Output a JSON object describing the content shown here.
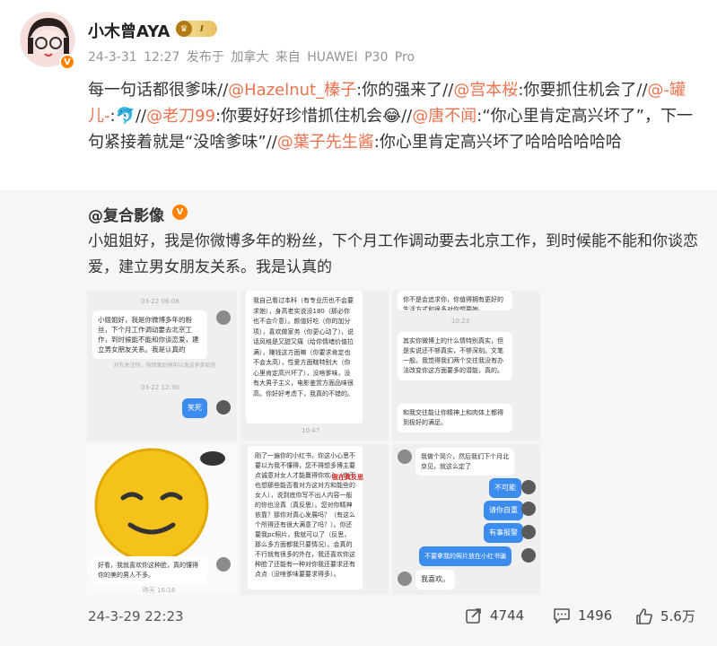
{
  "post": {
    "username": "小木曾AYA",
    "vip_level": "I",
    "meta": "24-3-31 12:27 发布于 加拿大 来自 HUAWEI P30 Pro",
    "text_segments": [
      "每一句话都很爹味//",
      "@Hazelnut_榛子",
      ":你的强来了//",
      "@宫本桜",
      ":你要抓住机会了//",
      "@-罐儿-",
      ":🐬//",
      "@老刀99",
      ":你要好好珍惜抓住机会😂//",
      "@唐不闻",
      ":“你心里肯定高兴坏了”，下一句紧接着就是“没啥爹味”//",
      "@葉子先生酱",
      ":你心里肯定高兴坏了哈哈哈哈哈哈"
    ]
  },
  "repost": {
    "author": "@复合影像",
    "text": "小姐姐好，我是你微博多年的粉丝，下个月工作调动要去北京工作，到时候能不能和你谈恋爱，建立男女朋友关系。我是认真的",
    "images": {
      "img1": {
        "time1": "03-22 06:08",
        "msg1": "小姐姐好，我是你微博多年的粉丝，下个月工作调动要去北京工作，到时候能不能和你谈恋爱，建立男女朋友关系。我是认真的",
        "note": "对方关注你，你回复后他可以发送多条私信",
        "time2": "03-22 12:30",
        "reply": "笑死"
      },
      "img2": {
        "doc": "我自己看过本科（有专业历也不会要求她），身高老实说没180（那必你也不会介意）。颜值好吃（你的加分项），喜欢做家务（你更心动了），说话风格是又甜又痛（给你情绪价值拉满），赚钱这方面嘛（你要求肯定也不会太高），性爱方面瞎特别大（你心里肯定高兴坏了），没啥爹味，没有大男子主义，电影鉴赏方面品味很高。你好好考虑下，我真的不错的。",
        "time": "10:47"
      },
      "img3": {
        "msg1": "你不是会追求你，你值得拥有更好的生活方式和很多对你想要她。",
        "time": "10:23",
        "msg2": "其实你微博上的什么情特别真实，但是实说还不够真实，不够深刻。文笔一般。我觉得我们两个交往我没有办法改变你这方面要多的潜能，真的。",
        "msg3": "和我交往能让你精神上和肉体上都得到极好的满足。"
      },
      "img4": {
        "msg": "好看，我就喜欢你这种脸，真的懂得你的美的男人不多。",
        "time": "昨天 16:16"
      },
      "img5": {
        "doc": "刚了一遍你的小红书，你这小心思不要以为我不懂得，您不得想多博主要点诚意对女人才能赢得你欢心（你不也想那些能否看对方这对方和能些的女人），说到底你写不出人内容一般的你也没真（真反思）。您对你精神依靠？那你对真心发展吗？（有这么个所得还有很大满意了吗？）。你还要我pc照片，我就可以了（反思，那么多方面都我只要情况）。会真的不行就有很多的外在，我还喜欢你这种脸了还能有一种对你我还要求还有点点（没啥爹味要要求得多）。",
        "annotation": "我在真反思"
      },
      "img6": {
        "msg1": "我做个简介，然后我们下个月北京见，就这么定了",
        "btn1": "不可能",
        "btn2": "请你自重",
        "btn3": "有事报警",
        "btn4": "不要拿我的照片放在小红书骗",
        "msg2": "我喜欢。"
      }
    }
  },
  "footer": {
    "date": "24-3-29 22:23",
    "shares": "4744",
    "comments": "1496",
    "likes": "5.6万"
  },
  "colors": {
    "mention": "#eb7350",
    "accent_orange": "#ff8200",
    "bubble_blue": "#3c8cf0"
  }
}
